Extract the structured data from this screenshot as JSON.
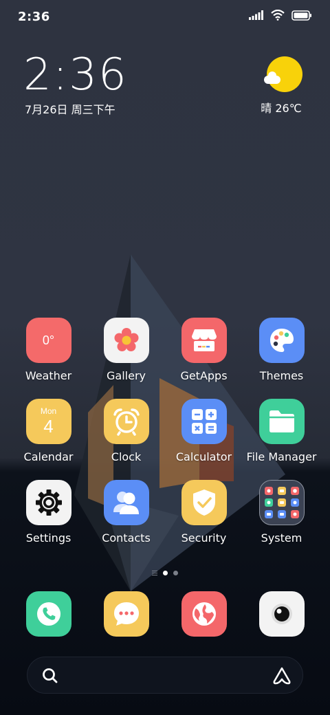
{
  "status_bar": {
    "time": "2:36"
  },
  "clock_widget": {
    "time": "2:36",
    "date": "7月26日 周三下午"
  },
  "weather_widget": {
    "text": "晴 26℃"
  },
  "apps": [
    {
      "label": "Weather",
      "icon": "weather-icon",
      "icon_text": "0°",
      "color": "#f46a6a"
    },
    {
      "label": "Gallery",
      "icon": "gallery-flower-icon",
      "color": "#f3f3f3"
    },
    {
      "label": "GetApps",
      "icon": "getapps-store-icon",
      "color": "#f4676a"
    },
    {
      "label": "Themes",
      "icon": "themes-palette-icon",
      "color": "#5b8ef6"
    },
    {
      "label": "Calendar",
      "icon": "calendar-icon",
      "icon_day": "Mon",
      "icon_date": "4",
      "color": "#f5c95b"
    },
    {
      "label": "Clock",
      "icon": "alarm-clock-icon",
      "color": "#f5c95b"
    },
    {
      "label": "Calculator",
      "icon": "calculator-icon",
      "color": "#5b8ef6"
    },
    {
      "label": "File Manager",
      "icon": "folder-icon",
      "color": "#3fcf9a"
    },
    {
      "label": "Settings",
      "icon": "gear-icon",
      "color": "#f3f3f3"
    },
    {
      "label": "Contacts",
      "icon": "contacts-icon",
      "color": "#5b8ef6"
    },
    {
      "label": "Security",
      "icon": "shield-check-icon",
      "color": "#f5c95b"
    },
    {
      "label": "System",
      "icon": "folder-grid-icon",
      "color": "#3b4253"
    }
  ],
  "dock": [
    {
      "name": "phone",
      "icon": "phone-icon",
      "color": "#3fcf9a"
    },
    {
      "name": "messages",
      "icon": "message-icon",
      "color": "#f5c95b"
    },
    {
      "name": "browser",
      "icon": "globe-icon",
      "color": "#f4676a"
    },
    {
      "name": "camera",
      "icon": "camera-icon",
      "color": "#f3f3f3"
    }
  ],
  "pager": {
    "pages": 2,
    "active": 1
  },
  "search": {
    "icons": [
      "search-icon",
      "assistant-icon"
    ]
  }
}
